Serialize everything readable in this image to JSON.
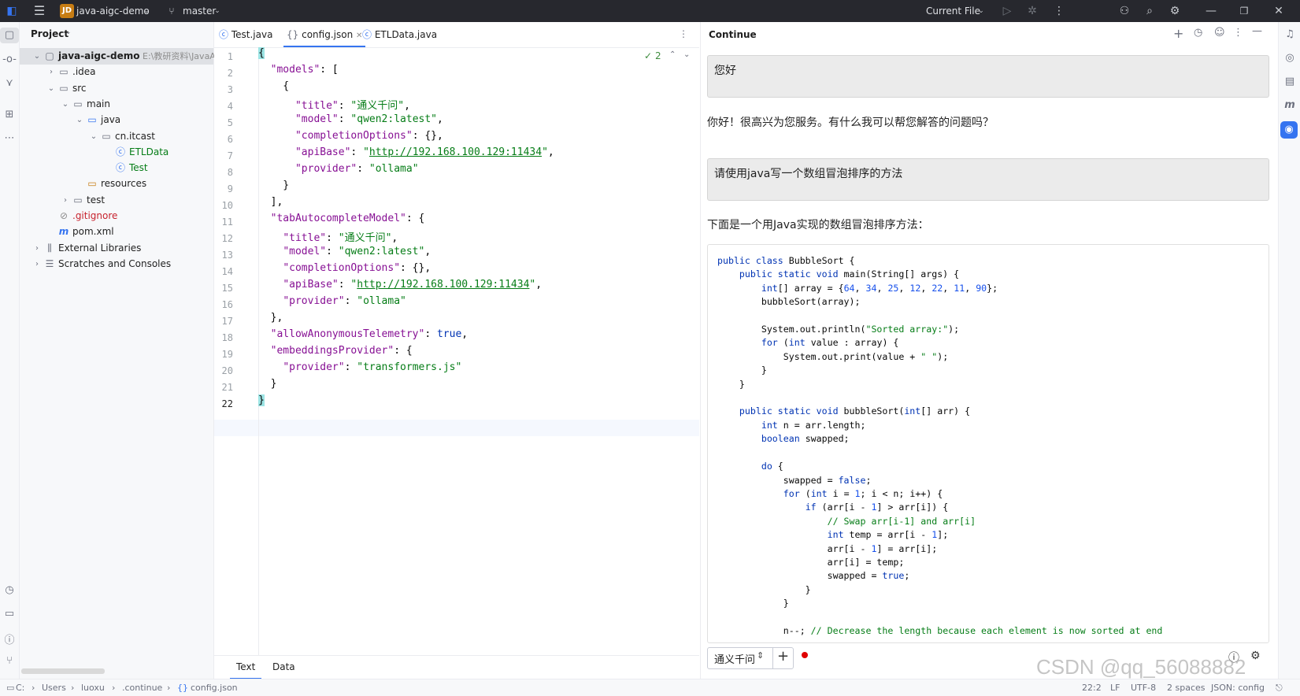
{
  "titlebar": {
    "project_badge": "JD",
    "project_name": "java-aigc-demo",
    "branch": "master",
    "run_config": "Current File"
  },
  "project_panel": {
    "title": "Project",
    "tree": [
      {
        "label": "java-aigc-demo",
        "path": "E:\\教研资料\\JavaA",
        "indent": 0,
        "arrow": "▾",
        "icon": "module-folder-icon"
      },
      {
        "label": ".idea",
        "indent": 1,
        "arrow": "›",
        "icon": "folder-icon"
      },
      {
        "label": "src",
        "indent": 1,
        "arrow": "▾",
        "icon": "folder-icon"
      },
      {
        "label": "main",
        "indent": 2,
        "arrow": "▾",
        "icon": "folder-icon"
      },
      {
        "label": "java",
        "indent": 3,
        "arrow": "▾",
        "icon": "source-folder-icon"
      },
      {
        "label": "cn.itcast",
        "indent": 4,
        "arrow": "▾",
        "icon": "package-icon"
      },
      {
        "label": "ETLData",
        "indent": 5,
        "arrow": "",
        "icon": "class-icon"
      },
      {
        "label": "Test",
        "indent": 5,
        "arrow": "",
        "icon": "class-icon"
      },
      {
        "label": "resources",
        "indent": 3,
        "arrow": "",
        "icon": "resources-folder-icon"
      },
      {
        "label": "test",
        "indent": 2,
        "arrow": "›",
        "icon": "folder-icon"
      },
      {
        "label": ".gitignore",
        "indent": 1,
        "arrow": "",
        "icon": "gitignore-icon"
      },
      {
        "label": "pom.xml",
        "indent": 1,
        "arrow": "",
        "icon": "maven-icon"
      },
      {
        "label": "External Libraries",
        "indent": 0,
        "arrow": "›",
        "icon": "library-icon"
      },
      {
        "label": "Scratches and Consoles",
        "indent": 0,
        "arrow": "›",
        "icon": "scratches-icon"
      }
    ]
  },
  "editor": {
    "tabs": [
      "Test.java",
      "config.json",
      "ETLData.java"
    ],
    "active_tab": "config.json",
    "inspection_count": "2",
    "bottom_tabs": [
      "Text",
      "Data"
    ],
    "line_numbers": [
      "1",
      "2",
      "3",
      "4",
      "5",
      "6",
      "7",
      "8",
      "9",
      "10",
      "11",
      "12",
      "13",
      "14",
      "15",
      "16",
      "17",
      "18",
      "19",
      "20",
      "21",
      "22"
    ]
  },
  "chat": {
    "title": "Continue",
    "messages": [
      {
        "role": "user",
        "text": "您好"
      },
      {
        "role": "assistant",
        "text": "你好！很高兴为您服务。有什么我可以帮您解答的问题吗？"
      },
      {
        "role": "user",
        "text": "请使用java写一个数组冒泡排序的方法"
      },
      {
        "role": "assistant",
        "text": "下面是一个用Java实现的数组冒泡排序方法："
      }
    ],
    "model_selector": "通义千问"
  },
  "statusbar": {
    "breadcrumb": [
      "C:",
      "Users",
      "luoxu",
      ".continue",
      "config.json"
    ],
    "position": "22:2",
    "line_sep": "LF",
    "encoding": "UTF-8",
    "indent": "2 spaces",
    "schema": "JSON: config"
  },
  "watermark": "CSDN @qq_56088882"
}
